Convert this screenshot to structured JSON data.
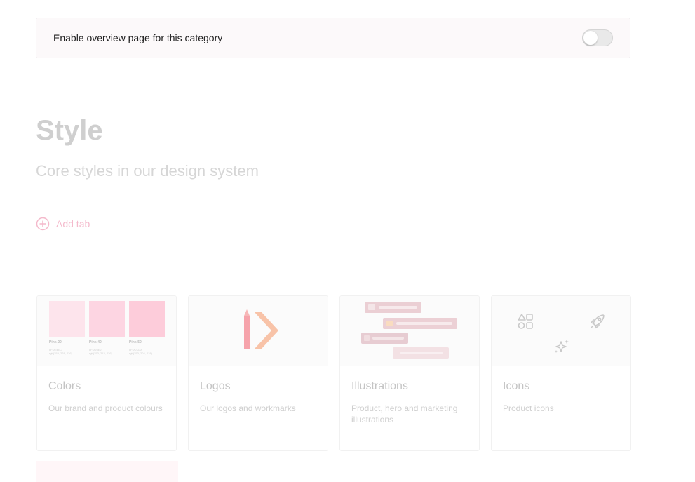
{
  "overview": {
    "label": "Enable overview page for this category",
    "enabled": false
  },
  "header": {
    "title": "Style",
    "subtitle": "Core styles in our design system"
  },
  "add_tab_label": "Add tab",
  "colors": {
    "accent": "#f4b9cb",
    "swatch_20": "#fde4ec",
    "swatch_40": "#fdd5e2",
    "swatch_50": "#fdccda"
  },
  "cards": [
    {
      "title": "Colors",
      "description": "Our brand and product colours",
      "swatches": [
        {
          "name": "Pink-20",
          "hex": "#FDE4EC",
          "rgb": "rgb(253, 228, 236)"
        },
        {
          "name": "Pink-40",
          "hex": "#FDD5E2",
          "rgb": "rgb(253, 213, 226)"
        },
        {
          "name": "Pink-50",
          "hex": "#FDCCDA",
          "rgb": "rgb(253, 204, 218)"
        }
      ]
    },
    {
      "title": "Logos",
      "description": "Our logos and workmarks",
      "icon": "logo-mark-icon"
    },
    {
      "title": "Illustrations",
      "description": "Product, hero and marketing illustrations",
      "icon": "illustration-bars-icon"
    },
    {
      "title": "Icons",
      "description": "Product icons",
      "icons": [
        "shapes-icon",
        "rocket-icon",
        "sparkles-icon"
      ]
    }
  ]
}
